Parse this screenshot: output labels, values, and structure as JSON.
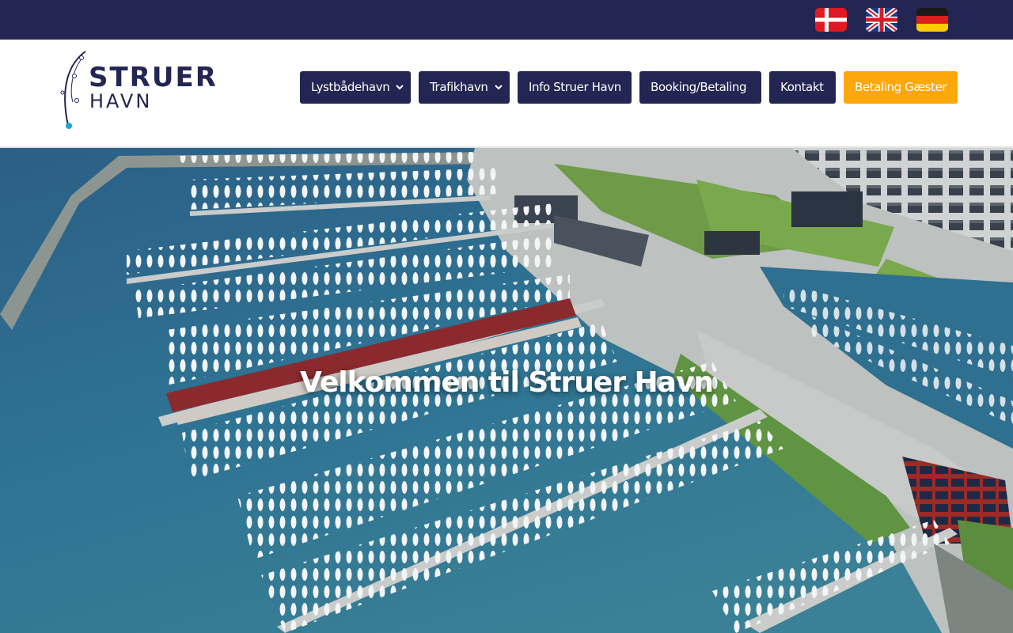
{
  "topbar": {
    "languages": [
      {
        "name": "danish-flag-icon",
        "lang": "Dansk"
      },
      {
        "name": "uk-flag-icon",
        "lang": "English"
      },
      {
        "name": "german-flag-icon",
        "lang": "Deutsch"
      }
    ]
  },
  "logo": {
    "line1": "STRUER",
    "line2": "HAVN"
  },
  "nav": {
    "items": [
      {
        "label": "Lystbådehavn",
        "has_dropdown": true
      },
      {
        "label": "Trafikhavn",
        "has_dropdown": true
      },
      {
        "label": "Info Struer Havn",
        "has_dropdown": false
      },
      {
        "label": "Booking/Betaling",
        "has_dropdown": false
      },
      {
        "label": "Kontakt",
        "has_dropdown": false
      },
      {
        "label": "Betaling Gæster",
        "has_dropdown": false
      }
    ]
  },
  "hero": {
    "title": "Velkommen til Struer Havn",
    "image": "aerial-harbor-photo"
  },
  "colors": {
    "navy": "#232552",
    "accent": "#fca80a",
    "logo_dot": "#1aa3e0"
  }
}
